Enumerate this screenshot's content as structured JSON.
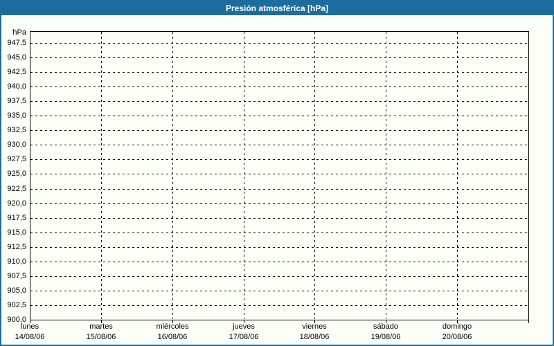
{
  "window": {
    "title": "Presión atmosférica [hPa]"
  },
  "colors": {
    "chrome_blue": "#1C6CA0",
    "background": "#FCFEF8",
    "grid": "#000000",
    "label_text": "#000000",
    "title_text": "#FFFFFF"
  },
  "chart_data": {
    "type": "line",
    "title": "Presión atmosférica [hPa]",
    "ylabel": "hPa",
    "xlabel": "",
    "ylim": [
      900,
      950
    ],
    "ytick_step": 2.5,
    "ytick_values": [
      947.5,
      945.0,
      942.5,
      940.0,
      937.5,
      935.0,
      932.5,
      930.0,
      927.5,
      925.0,
      922.5,
      920.0,
      917.5,
      915.0,
      912.5,
      910.0,
      907.5,
      905.0,
      902.5,
      900.0
    ],
    "ytick_labels": [
      "947,5",
      "945,0",
      "942,5",
      "940,0",
      "937,5",
      "935,0",
      "932,5",
      "930,0",
      "927,5",
      "925,0",
      "922,5",
      "920,0",
      "917,5",
      "915,0",
      "912,5",
      "910,0",
      "907,5",
      "905,0",
      "902,5",
      "900,0"
    ],
    "x_ticks": [
      {
        "day": "lunes",
        "date": "14/08/06"
      },
      {
        "day": "martes",
        "date": "15/08/06"
      },
      {
        "day": "miércoles",
        "date": "16/08/06"
      },
      {
        "day": "jueves",
        "date": "17/08/06"
      },
      {
        "day": "viernes",
        "date": "18/08/06"
      },
      {
        "day": "sábado",
        "date": "19/08/06"
      },
      {
        "day": "domingo",
        "date": "20/08/06"
      }
    ],
    "x_span_days": 7,
    "grid": "dashed",
    "legend": "none",
    "series": []
  }
}
